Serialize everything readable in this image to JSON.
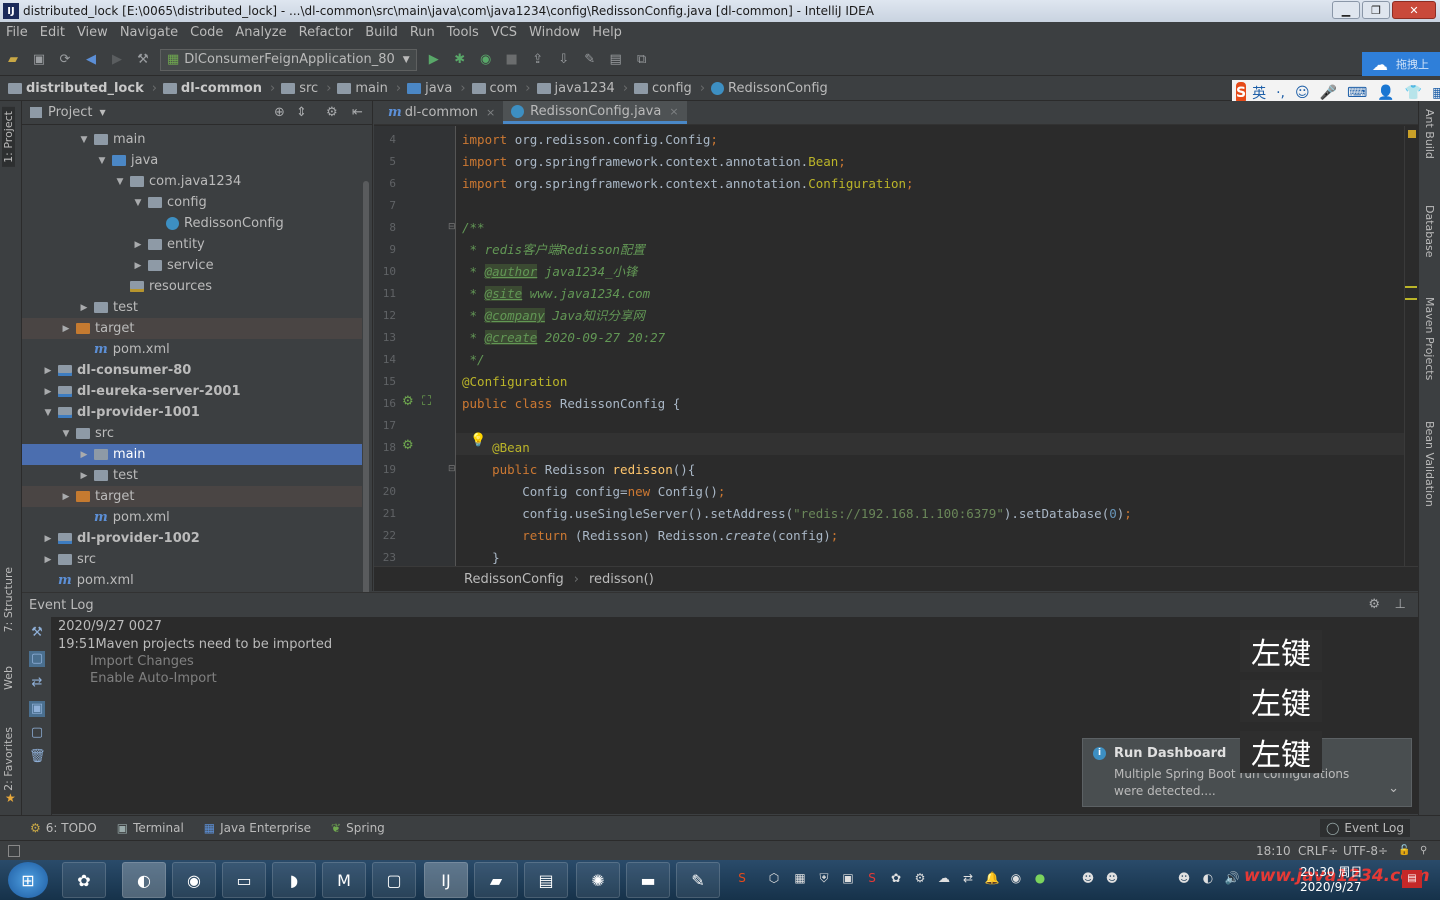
{
  "window": {
    "title": "distributed_lock [E:\\0065\\distributed_lock] - ...\\dl-common\\src\\main\\java\\com\\java1234\\config\\RedissonConfig.java [dl-common] - IntelliJ IDEA",
    "logo": "IJ"
  },
  "menu": [
    "File",
    "Edit",
    "View",
    "Navigate",
    "Code",
    "Analyze",
    "Refactor",
    "Build",
    "Run",
    "Tools",
    "VCS",
    "Window",
    "Help"
  ],
  "toolbar": {
    "run_config": "DlConsumerFeignApplication_80"
  },
  "navbar": [
    "distributed_lock",
    "dl-common",
    "src",
    "main",
    "java",
    "com",
    "java1234",
    "config",
    "RedissonConfig"
  ],
  "baidu": {
    "label": "拖拽上"
  },
  "ime": {
    "label": "英"
  },
  "project_panel": {
    "title": "Project",
    "tree": [
      {
        "label": "main",
        "depth": 3,
        "expanded": true,
        "kind": "folder"
      },
      {
        "label": "java",
        "depth": 4,
        "expanded": true,
        "kind": "src"
      },
      {
        "label": "com.java1234",
        "depth": 5,
        "expanded": true,
        "kind": "folder"
      },
      {
        "label": "config",
        "depth": 6,
        "expanded": true,
        "kind": "folder"
      },
      {
        "label": "RedissonConfig",
        "depth": 7,
        "kind": "class"
      },
      {
        "label": "entity",
        "depth": 6,
        "expanded": false,
        "kind": "folder"
      },
      {
        "label": "service",
        "depth": 6,
        "expanded": false,
        "kind": "folder"
      },
      {
        "label": "resources",
        "depth": 5,
        "kind": "res"
      },
      {
        "label": "test",
        "depth": 3,
        "expanded": false,
        "kind": "folder"
      },
      {
        "label": "target",
        "depth": 2,
        "expanded": false,
        "kind": "orange",
        "excluded": true
      },
      {
        "label": "pom.xml",
        "depth": 3,
        "kind": "maven"
      },
      {
        "label": "dl-consumer-80",
        "depth": 1,
        "expanded": false,
        "kind": "module",
        "bold": true
      },
      {
        "label": "dl-eureka-server-2001",
        "depth": 1,
        "expanded": false,
        "kind": "module",
        "bold": true
      },
      {
        "label": "dl-provider-1001",
        "depth": 1,
        "expanded": true,
        "kind": "module",
        "bold": true
      },
      {
        "label": "src",
        "depth": 2,
        "expanded": true,
        "kind": "folder"
      },
      {
        "label": "main",
        "depth": 3,
        "expanded": false,
        "kind": "folder",
        "selected": true
      },
      {
        "label": "test",
        "depth": 3,
        "expanded": false,
        "kind": "folder"
      },
      {
        "label": "target",
        "depth": 2,
        "expanded": false,
        "kind": "orange",
        "excluded": true
      },
      {
        "label": "pom.xml",
        "depth": 3,
        "kind": "maven"
      },
      {
        "label": "dl-provider-1002",
        "depth": 1,
        "expanded": false,
        "kind": "module",
        "bold": true
      },
      {
        "label": "src",
        "depth": 1,
        "expanded": false,
        "kind": "folder"
      },
      {
        "label": "pom.xml",
        "depth": 1,
        "kind": "maven"
      }
    ]
  },
  "editor": {
    "tabs": [
      {
        "label": "dl-common",
        "active": false,
        "icon": "m"
      },
      {
        "label": "RedissonConfig.java",
        "active": true,
        "icon": "c"
      }
    ],
    "first_line": 4,
    "lines": [
      [
        [
          "kw",
          "import "
        ],
        [
          "",
          "org.redisson.config.Config"
        ],
        [
          "kw",
          ";"
        ]
      ],
      [
        [
          "kw",
          "import "
        ],
        [
          "",
          "org.springframework.context.annotation."
        ],
        [
          "ann",
          "Bean"
        ],
        [
          "kw",
          ";"
        ]
      ],
      [
        [
          "kw",
          "import "
        ],
        [
          "",
          "org.springframework.context.annotation."
        ],
        [
          "ann",
          "Configuration"
        ],
        [
          "kw",
          ";"
        ]
      ],
      [],
      [
        [
          "cm",
          "/**"
        ]
      ],
      [
        [
          "cm",
          " * redis客户端Redisson配置"
        ]
      ],
      [
        [
          "cm",
          " * "
        ],
        [
          "tag",
          "@author"
        ],
        [
          "cm",
          " java1234_小锋"
        ]
      ],
      [
        [
          "cm",
          " * "
        ],
        [
          "tag",
          "@site"
        ],
        [
          "cm",
          " www.java1234.com"
        ]
      ],
      [
        [
          "cm",
          " * "
        ],
        [
          "tag",
          "@company"
        ],
        [
          "cm",
          " Java知识分享网"
        ]
      ],
      [
        [
          "cm",
          " * "
        ],
        [
          "tag",
          "@create"
        ],
        [
          "cm",
          " 2020-09-27 20:27"
        ]
      ],
      [
        [
          "cm",
          " */"
        ]
      ],
      [
        [
          "ann",
          "@Configuration"
        ]
      ],
      [
        [
          "kw",
          "public class "
        ],
        [
          "",
          "RedissonConfig {"
        ]
      ],
      [],
      [
        [
          "",
          "    "
        ],
        [
          "ann",
          "@Bean"
        ]
      ],
      [
        [
          "",
          "    "
        ],
        [
          "kw",
          "public "
        ],
        [
          "",
          "Redisson "
        ],
        [
          "fn",
          "redisson"
        ],
        [
          "",
          "(){"
        ]
      ],
      [
        [
          "",
          "        Config config="
        ],
        [
          "kw",
          "new "
        ],
        [
          "",
          "Config()"
        ],
        [
          "kw",
          ";"
        ]
      ],
      [
        [
          "",
          "        config.useSingleServer().setAddress("
        ],
        [
          "str",
          "\"redis://192.168.1.100:6379\""
        ],
        [
          "",
          ").setDatabase("
        ],
        [
          "num",
          "0"
        ],
        [
          "",
          ")"
        ],
        [
          "kw",
          ";"
        ]
      ],
      [
        [
          "",
          "        "
        ],
        [
          "kw",
          "return "
        ],
        [
          "",
          "(Redisson) Redisson."
        ],
        [
          "it",
          "create"
        ],
        [
          "",
          "(config)"
        ],
        [
          "kw",
          ";"
        ]
      ],
      [
        [
          "",
          "    }"
        ]
      ]
    ],
    "breadcrumb": [
      "RedissonConfig",
      "redisson()"
    ]
  },
  "left_tool_tabs": [
    "1: Project",
    "7: Structure",
    "Web",
    "2: Favorites"
  ],
  "right_tool_tabs": [
    "Ant Build",
    "Database",
    "Maven Projects",
    "Bean Validation"
  ],
  "event_log": {
    "title": "Event Log",
    "date": "2020/9/27 0027",
    "time": "19:51",
    "message": "Maven projects need to be imported",
    "links": [
      "Import Changes",
      "Enable Auto-Import"
    ],
    "overlay_keys": [
      "左键",
      "左键",
      "左键"
    ]
  },
  "notification": {
    "title": "Run Dashboard",
    "body": "Multiple Spring Boot run configurations were detected...."
  },
  "bottom_tabs": [
    {
      "label": "6: TODO",
      "icon": "todo-icon"
    },
    {
      "label": "Terminal",
      "icon": "terminal-icon"
    },
    {
      "label": "Java Enterprise",
      "icon": "java-enterprise-icon"
    },
    {
      "label": "Spring",
      "icon": "spring-icon"
    }
  ],
  "event_log_tab": "Event Log",
  "status": {
    "position": "18:10",
    "line_sep": "CRLF÷",
    "encoding": "UTF-8÷"
  },
  "taskbar": {
    "time": "20:30 周日",
    "date": "2020/9/27",
    "watermark": "www.java1234.com"
  }
}
